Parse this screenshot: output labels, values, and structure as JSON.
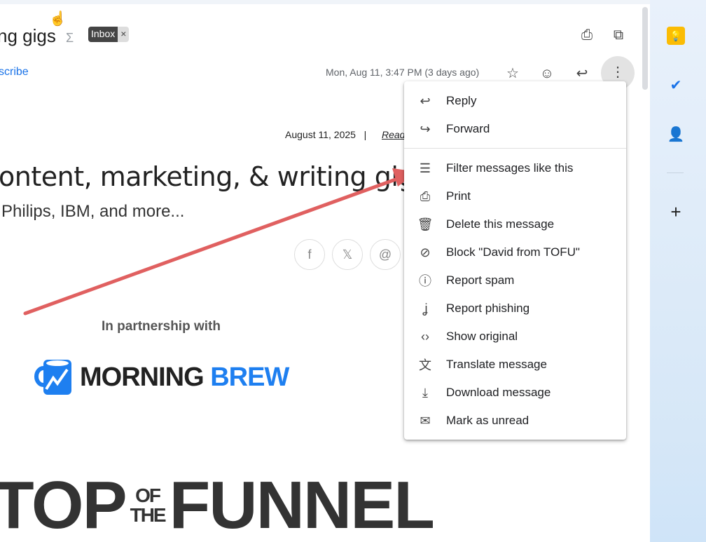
{
  "header": {
    "subject": "ng gigs",
    "label": "Inbox",
    "label_remove": "×",
    "unsubscribe": "scribe",
    "date": "Mon, Aug 11, 3:47 PM (3 days ago)"
  },
  "email": {
    "date": "August 11, 2025",
    "separator": "|",
    "read_link": "Read",
    "headline": "ontent, marketing, & writing gigs",
    "subheadline": "Philips, IBM, and more...",
    "partner_text": "In partnership with",
    "brand_1": "MORNING",
    "brand_2": "BREW",
    "logo": {
      "top": "TOP",
      "of": "OF",
      "the": "THE",
      "funnel": "FUNNEL"
    }
  },
  "menu": {
    "items": [
      {
        "label": "Reply",
        "icon": "reply-icon",
        "glyph": "↩"
      },
      {
        "label": "Forward",
        "icon": "forward-icon",
        "glyph": "↪"
      },
      {
        "label": "Filter messages like this",
        "icon": "filter-icon",
        "glyph": "☰"
      },
      {
        "label": "Print",
        "icon": "print-icon",
        "glyph": "⎙"
      },
      {
        "label": "Delete this message",
        "icon": "trash-icon",
        "glyph": "🗑"
      },
      {
        "label": "Block \"David from TOFU\"",
        "icon": "block-icon",
        "glyph": "⊘"
      },
      {
        "label": "Report spam",
        "icon": "spam-icon",
        "glyph": "ⓘ"
      },
      {
        "label": "Report phishing",
        "icon": "phishing-hook-icon",
        "glyph": "ʝ"
      },
      {
        "label": "Show original",
        "icon": "code-icon",
        "glyph": "‹›"
      },
      {
        "label": "Translate message",
        "icon": "translate-icon",
        "glyph": "文"
      },
      {
        "label": "Download message",
        "icon": "download-icon",
        "glyph": "⤓"
      },
      {
        "label": "Mark as unread",
        "icon": "mark-unread-icon",
        "glyph": "✉"
      }
    ]
  },
  "colors": {
    "accent": "#1a73e8",
    "arrow": "#e06060"
  }
}
